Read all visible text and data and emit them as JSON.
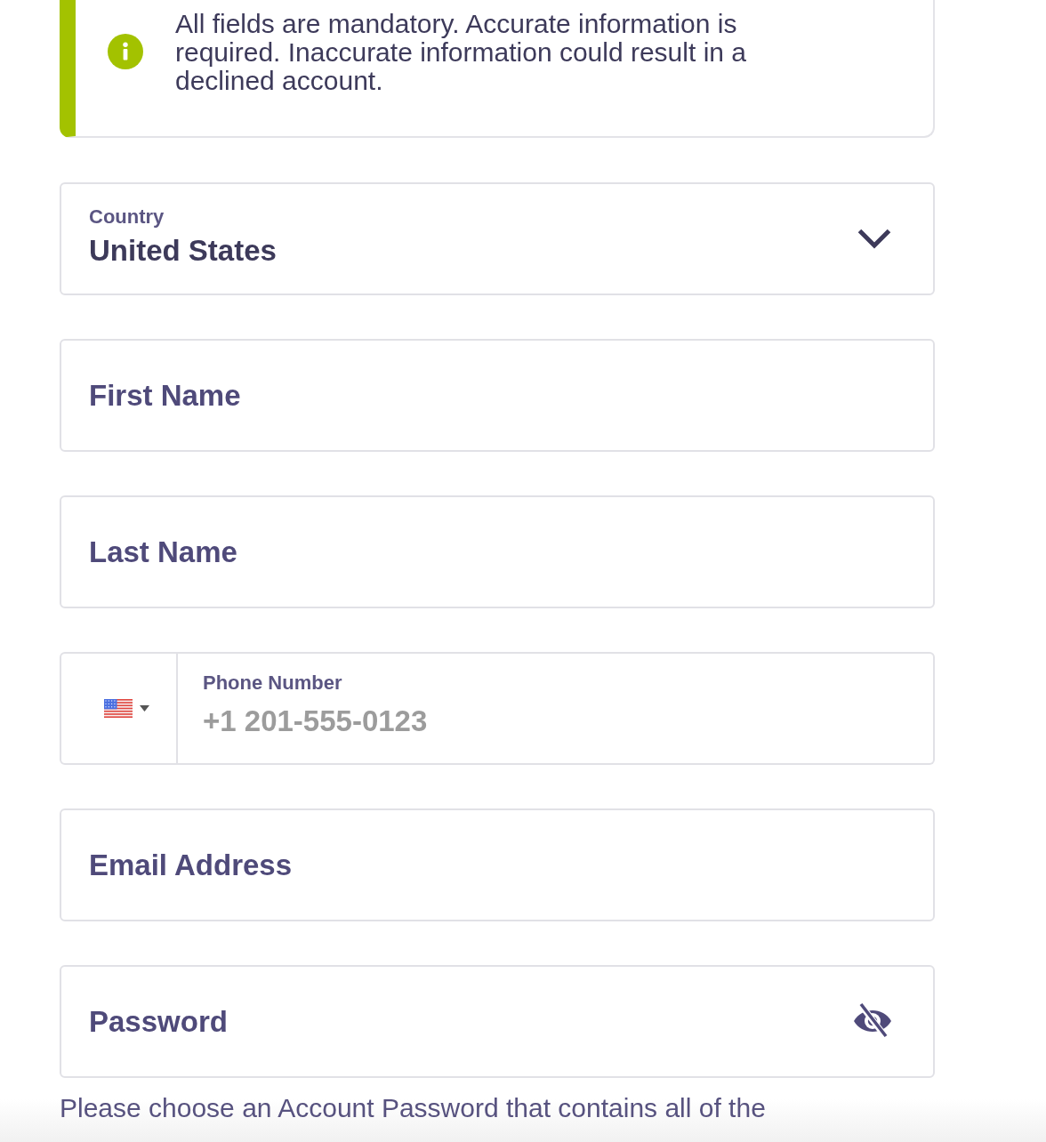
{
  "alert": {
    "message": "All fields are mandatory. Accurate information is required. Inaccurate information could result in a declined account."
  },
  "fields": [
    {
      "kind": "select",
      "label": "Country",
      "value": "United States"
    },
    {
      "kind": "text",
      "placeholder": "First Name"
    },
    {
      "kind": "text",
      "placeholder": "Last Name"
    },
    {
      "kind": "phone",
      "label": "Phone Number",
      "placeholder": "+1 201-555-0123"
    },
    {
      "kind": "text",
      "placeholder": "Email Address"
    },
    {
      "kind": "password",
      "placeholder": "Password",
      "revealed": false
    }
  ],
  "password_hint": "Please choose an Account Password that contains all of the"
}
